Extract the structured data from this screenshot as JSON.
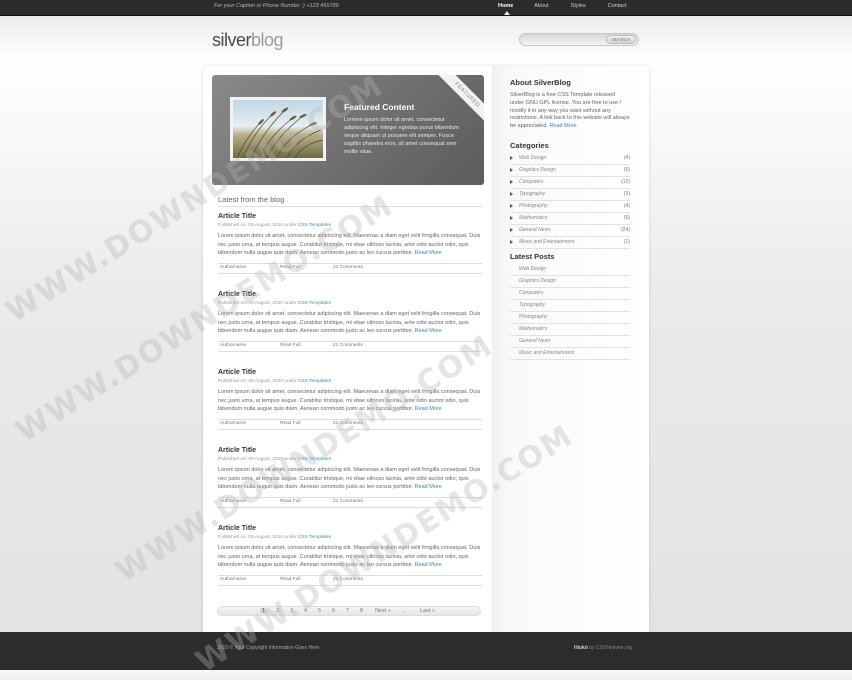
{
  "topbar": {
    "caption": "For your Caption or Phone Number :) +123 456789",
    "nav": [
      "Home",
      "About",
      "Styles",
      "Contact"
    ],
    "active_index": 0
  },
  "header": {
    "logo_bold": "silver",
    "logo_light": "blog",
    "search_placeholder": "",
    "search_button": "SEARCH"
  },
  "featured": {
    "title": "Featured Content",
    "text": "Loreme ipsum dolor sit amet, consectetur adipiscing elit. Integer egestas purus bibendum neque aliquam ut posuere elit semper. Fusce sagittis pharetra eros, sit amet consequat sem mollis vitae.",
    "ribbon": "FEATURED"
  },
  "blog": {
    "section_title": "Latest from the blog",
    "articles": [
      {
        "title": "Article Title",
        "meta_prefix": "Published on: 08 August, 2010 under",
        "meta_link": "CSS Templates",
        "body": "Lorem ipsum dolor sit amet, consectetur adipiscing elit. Maecenas a diam eget velit fringilla consequat. Duis nec justo urna, at tempus augue. Curabitur tristique, mi vitae ultrices lacinia, ante odio auctor odio, quis bibendum nulla augue quis diam. Aenean commodo justo ac leo cursus porttitor.",
        "read_more": "Read More",
        "author": "Authorname",
        "read_full": "Read Full",
        "comments": "21 Comments"
      },
      {
        "title": "Article Title",
        "meta_prefix": "Published on: 08 August, 2010 under",
        "meta_link": "CSS Templates",
        "body": "Lorem ipsum dolor sit amet, consectetur adipiscing elit. Maecenas a diam eget velit fringilla consequat. Duis nec justo urna, at tempus augue. Curabitur tristique, mi vitae ultrices lacinia, ante odio auctor odio, quis bibendum nulla augue quis diam. Aenean commodo justo ac leo cursus porttitor.",
        "read_more": "Read More",
        "author": "Authorname",
        "read_full": "Read Full",
        "comments": "21 Comments"
      },
      {
        "title": "Article Title",
        "meta_prefix": "Published on: 08 August, 2010 under",
        "meta_link": "CSS Templates",
        "body": "Lorem ipsum dolor sit amet, consectetur adipiscing elit. Maecenas a diam eget velit fringilla consequat. Duis nec justo urna, at tempus augue. Curabitur tristique, mi vitae ultrices lacinia, ante odio auctor odio, quis bibendum nulla augue quis diam. Aenean commodo justo ac leo cursus porttitor.",
        "read_more": "Read More",
        "author": "Authorname",
        "read_full": "Read Full",
        "comments": "21 Comments"
      },
      {
        "title": "Article Title",
        "meta_prefix": "Published on: 08 August, 2010 under",
        "meta_link": "CSS Templates",
        "body": "Lorem ipsum dolor sit amet, consectetur adipiscing elit. Maecenas a diam eget velit fringilla consequat. Duis nec justo urna, at tempus augue. Curabitur tristique, mi vitae ultrices lacinia, ante odio auctor odio, quis bibendum nulla augue quis diam. Aenean commodo justo ac leo cursus porttitor.",
        "read_more": "Read More",
        "author": "Authorname",
        "read_full": "Read Full",
        "comments": "21 Comments"
      },
      {
        "title": "Article Title",
        "meta_prefix": "Published on: 08 August, 2010 under",
        "meta_link": "CSS Templates",
        "body": "Lorem ipsum dolor sit amet, consectetur adipiscing elit. Maecenas a diam eget velit fringilla consequat. Duis nec justo urna, at tempus augue. Curabitur tristique, mi vitae ultrices lacinia, ante odio auctor odio, quis bibendum nulla augue quis diam. Aenean commodo justo ac leo cursus porttitor.",
        "read_more": "Read More",
        "author": "Authorname",
        "read_full": "Read Full",
        "comments": "21 Comments"
      }
    ],
    "pagination": [
      "1",
      "2",
      "3",
      "4",
      "5",
      "6",
      "7",
      "8",
      "Next »",
      "...",
      "Last »"
    ],
    "current_page": "1"
  },
  "sidebar": {
    "about_title": "About SilverBlog",
    "about_text": "SilverBlog is a free CSS Template released under GNU GPL license. You are free to use / modify it in any way you want without any restrictions. A link back to this website will always be appreciated.",
    "about_link": "Read More",
    "categories_title": "Categories",
    "categories": [
      {
        "name": "Web Design",
        "count": "(4)"
      },
      {
        "name": "Graphics Design",
        "count": "(6)"
      },
      {
        "name": "Computers",
        "count": "(12)"
      },
      {
        "name": "Typography",
        "count": "(3)"
      },
      {
        "name": "Photography",
        "count": "(4)"
      },
      {
        "name": "Mathematics",
        "count": "(5)"
      },
      {
        "name": "General News",
        "count": "(24)"
      },
      {
        "name": "Music and Entertainment",
        "count": "(1)"
      }
    ],
    "posts_title": "Latest Posts",
    "posts": [
      "Web Design",
      "Graphics Design",
      "Computers",
      "Typography",
      "Photography",
      "Mathematics",
      "General News",
      "Music and Entertainment"
    ]
  },
  "footer": {
    "copyright": "2010 © Your Copyright Information Goes Here",
    "credit_bold": "Hiukó",
    "credit_rest": "by CSSHeaven.org"
  },
  "watermark": "WWW.DOWNDEMO.COM"
}
